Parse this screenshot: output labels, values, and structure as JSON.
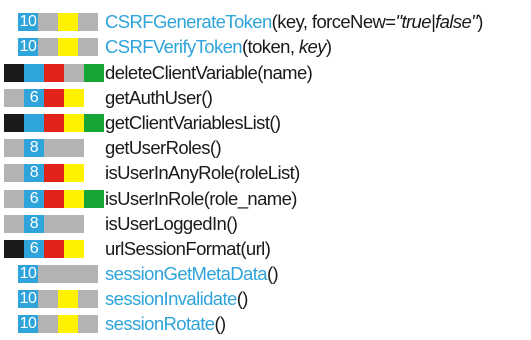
{
  "colors": {
    "black": "#1a1a1a",
    "blue": "#2ea4da",
    "red": "#e2231a",
    "green": "#17a535",
    "gray": "#b3b3b3",
    "yellow": "#fff200",
    "link": "#2ea4da",
    "text": "#1a1a1a"
  },
  "functions": [
    {
      "name": "CSRFGenerateToken",
      "args": "(key, forceNew=",
      "args_italic": "\"true|false\"",
      "args_end": ")",
      "link": true,
      "badge": "10",
      "swatches": [
        "badge-blue",
        "gray",
        "yellow",
        "gray"
      ]
    },
    {
      "name": "CSRFVerifyToken",
      "args": "(token, ",
      "args_italic": "key",
      "args_end": ")",
      "link": true,
      "badge": "10",
      "swatches": [
        "badge-blue",
        "gray",
        "yellow",
        "gray"
      ]
    },
    {
      "name": "deleteClientVariable",
      "args": "(name)",
      "args_italic": "",
      "args_end": "",
      "link": false,
      "badge": "",
      "swatches": [
        "black",
        "blue",
        "red",
        "gray",
        "green"
      ]
    },
    {
      "name": "getAuthUser",
      "args": "()",
      "args_italic": "",
      "args_end": "",
      "link": false,
      "badge": "6",
      "swatches": [
        "gray",
        "badge-blue",
        "red",
        "yellow"
      ]
    },
    {
      "name": "getClientVariablesList",
      "args": "()",
      "args_italic": "",
      "args_end": "",
      "link": false,
      "badge": "",
      "swatches": [
        "black",
        "blue",
        "red",
        "yellow",
        "green"
      ]
    },
    {
      "name": "getUserRoles",
      "args": "()",
      "args_italic": "",
      "args_end": "",
      "link": false,
      "badge": "8",
      "swatches": [
        "gray",
        "badge-blue",
        "gray",
        "gray"
      ]
    },
    {
      "name": "isUserInAnyRole",
      "args": "(roleList)",
      "args_italic": "",
      "args_end": "",
      "link": false,
      "badge": "8",
      "swatches": [
        "gray",
        "badge-blue",
        "red",
        "yellow"
      ]
    },
    {
      "name": "isUserInRole",
      "args": "(role_name)",
      "args_italic": "",
      "args_end": "",
      "link": false,
      "badge": "6",
      "swatches": [
        "gray",
        "badge-blue",
        "red",
        "yellow",
        "green"
      ]
    },
    {
      "name": "isUserLoggedIn",
      "args": "()",
      "args_italic": "",
      "args_end": "",
      "link": false,
      "badge": "8",
      "swatches": [
        "gray",
        "badge-blue",
        "gray",
        "gray"
      ]
    },
    {
      "name": "urlSessionFormat",
      "args": "(url)",
      "args_italic": "",
      "args_end": "",
      "link": false,
      "badge": "6",
      "swatches": [
        "black",
        "badge-blue",
        "red",
        "yellow"
      ]
    },
    {
      "name": "sessionGetMetaData",
      "args": "()",
      "args_italic": "",
      "args_end": "",
      "link": true,
      "badge": "10",
      "swatches": [
        "badge-blue",
        "gray",
        "gray",
        "gray"
      ]
    },
    {
      "name": "sessionInvalidate",
      "args": "()",
      "args_italic": "",
      "args_end": "",
      "link": true,
      "badge": "10",
      "swatches": [
        "badge-blue",
        "gray",
        "yellow",
        "gray"
      ]
    },
    {
      "name": "sessionRotate",
      "args": "()",
      "args_italic": "",
      "args_end": "",
      "link": true,
      "badge": "10",
      "swatches": [
        "badge-blue",
        "gray",
        "yellow",
        "gray"
      ]
    }
  ]
}
